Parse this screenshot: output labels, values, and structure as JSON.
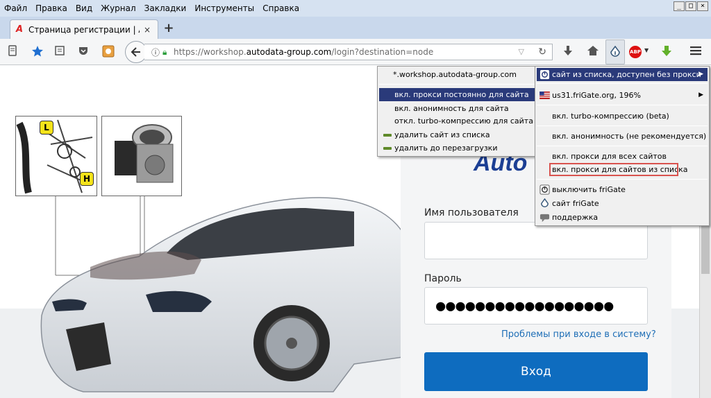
{
  "menubar": {
    "items": [
      "Файл",
      "Правка",
      "Вид",
      "Журнал",
      "Закладки",
      "Инструменты",
      "Справка"
    ],
    "window_buttons": [
      "_",
      "□",
      "×"
    ]
  },
  "tab": {
    "title": "Страница регистрации | Autoda",
    "favicon": "A",
    "close": "×",
    "new_tab": "+"
  },
  "navbar": {
    "url_prefix": "https://workshop.",
    "url_domain": "autodata-group.com",
    "url_suffix": "/login?destination=node"
  },
  "icons": {
    "ident": "ident-icon",
    "bookmark": "star-icon",
    "reader": "reader-icon",
    "pocket": "pocket-icon",
    "back": "back-arrow-icon",
    "download": "download-arrow-icon",
    "home": "home-icon",
    "frigate": "frigate-icon",
    "abp": "adblock-plus-icon",
    "green": "green-download-icon",
    "menu": "hamburger-menu-icon"
  },
  "abp_label": "ABP",
  "page": {
    "logo": "Auto",
    "diagram_labels": [
      "L",
      "H"
    ],
    "username_label": "Имя пользователя",
    "password_label": "Пароль",
    "password_value": "●●●●●●●●●●●●●●●●●●",
    "forgot_link": "Проблемы при входе в систему?",
    "login_button": "Вход"
  },
  "submenu": {
    "domain": "*.workshop.autodata-group.com",
    "items": [
      "вкл. прокси постоянно для сайта",
      "вкл. анонимность для сайта",
      "откл. turbo-компрессию для сайта",
      "удалить сайт из списка",
      "удалить до перезагрузки"
    ]
  },
  "frigate_menu": {
    "items": [
      "сайт из списка, доступен без прокси",
      "us31.friGate.org, 196%",
      "вкл. turbo-компрессию (beta)",
      "вкл. анонимность (не рекомендуется)",
      "вкл. прокси для всех сайтов",
      "вкл. прокси для сайтов из списка",
      "выключить friGate",
      "сайт friGate",
      "поддержка"
    ]
  },
  "colors": {
    "menu_selected": "#2a3a7a",
    "login_button": "#0e6cbf",
    "link": "#1e6eb6",
    "highlight_box": "#d9534f"
  }
}
